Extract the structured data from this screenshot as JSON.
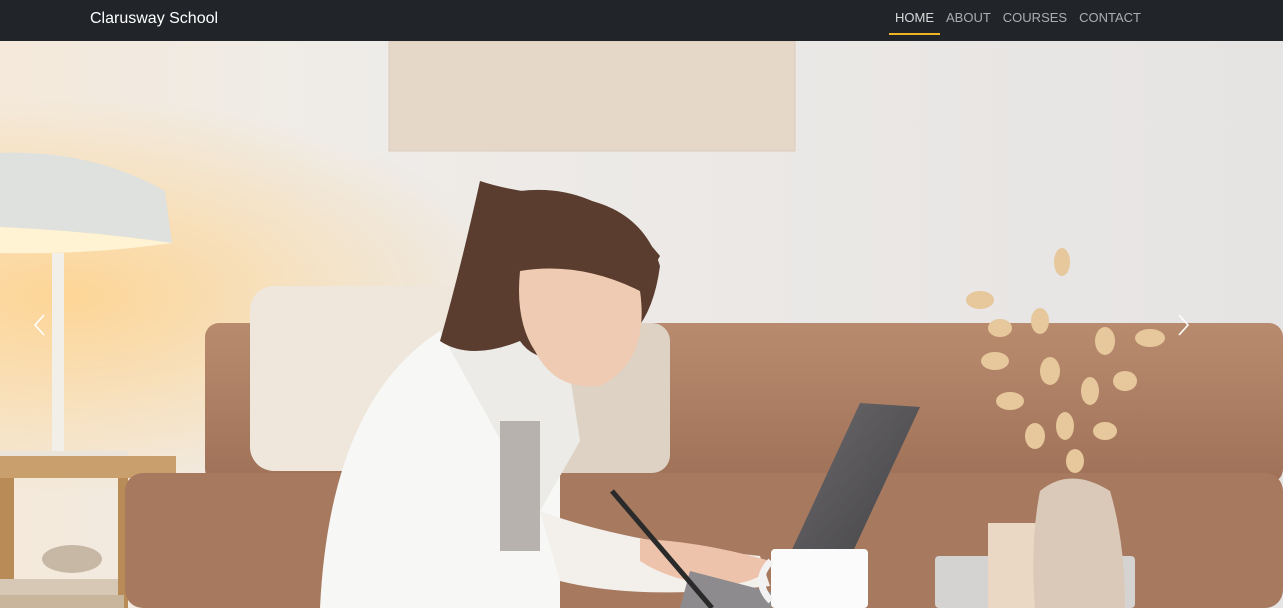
{
  "navbar": {
    "brand": "Clarusway School",
    "links": [
      {
        "label": "HOME",
        "active": true
      },
      {
        "label": "ABOUT",
        "active": false
      },
      {
        "label": "COURSES",
        "active": false
      },
      {
        "label": "CONTACT",
        "active": false
      }
    ],
    "active_accent": "#f0b323",
    "background": "#212529"
  },
  "carousel": {
    "prev_icon": "chevron-left-icon",
    "next_icon": "chevron-right-icon",
    "slide_image": "woman-writing-at-laptop-photo"
  }
}
